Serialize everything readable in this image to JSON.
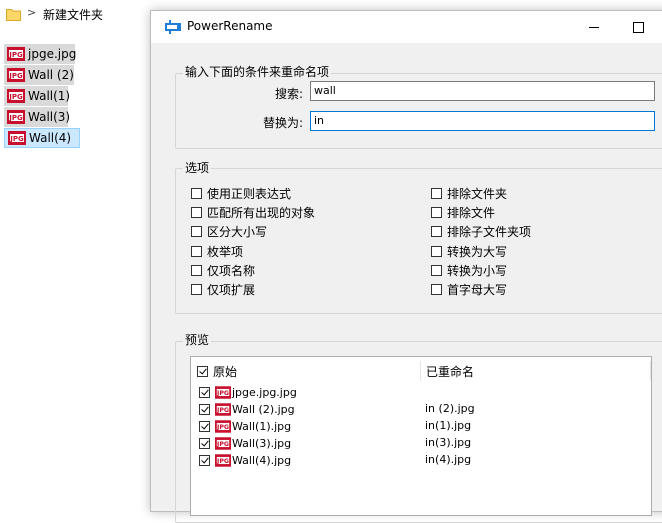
{
  "explorer": {
    "breadcrumb_sep": ">",
    "folder_name": "新建文件夹",
    "files": [
      {
        "name": "jpge.jpg",
        "selected": false
      },
      {
        "name": "Wall (2)",
        "selected": false
      },
      {
        "name": "Wall(1)",
        "selected": false
      },
      {
        "name": "Wall(3)",
        "selected": false
      },
      {
        "name": "Wall(4)",
        "selected": true
      }
    ]
  },
  "window": {
    "title": "PowerRename"
  },
  "search_group": {
    "title": "输入下面的条件来重命名项",
    "search_label": "搜索:",
    "search_value": "wall",
    "replace_label": "替换为:",
    "replace_value": "in"
  },
  "options": {
    "title": "选项",
    "left": [
      {
        "label": "使用正则表达式",
        "checked": false
      },
      {
        "label": "匹配所有出现的对象",
        "checked": false
      },
      {
        "label": "区分大小写",
        "checked": false
      },
      {
        "label": "枚举项",
        "checked": false
      },
      {
        "label": "仅项名称",
        "checked": false
      },
      {
        "label": "仅项扩展",
        "checked": false
      }
    ],
    "right": [
      {
        "label": "排除文件夹",
        "checked": false
      },
      {
        "label": "排除文件",
        "checked": false
      },
      {
        "label": "排除子文件夹项",
        "checked": false
      },
      {
        "label": "转换为大写",
        "checked": false
      },
      {
        "label": "转换为小写",
        "checked": false
      },
      {
        "label": "首字母大写",
        "checked": false
      }
    ]
  },
  "preview": {
    "title": "预览",
    "col_original": "原始",
    "col_renamed": "已重命名",
    "rows": [
      {
        "original": "jpge.jpg.jpg",
        "renamed": "",
        "checked": true
      },
      {
        "original": "Wall (2).jpg",
        "renamed": "in (2).jpg",
        "checked": true
      },
      {
        "original": "Wall(1).jpg",
        "renamed": "in(1).jpg",
        "checked": true
      },
      {
        "original": "Wall(3).jpg",
        "renamed": "in(3).jpg",
        "checked": true
      },
      {
        "original": "Wall(4).jpg",
        "renamed": "in(4).jpg",
        "checked": true
      }
    ]
  }
}
